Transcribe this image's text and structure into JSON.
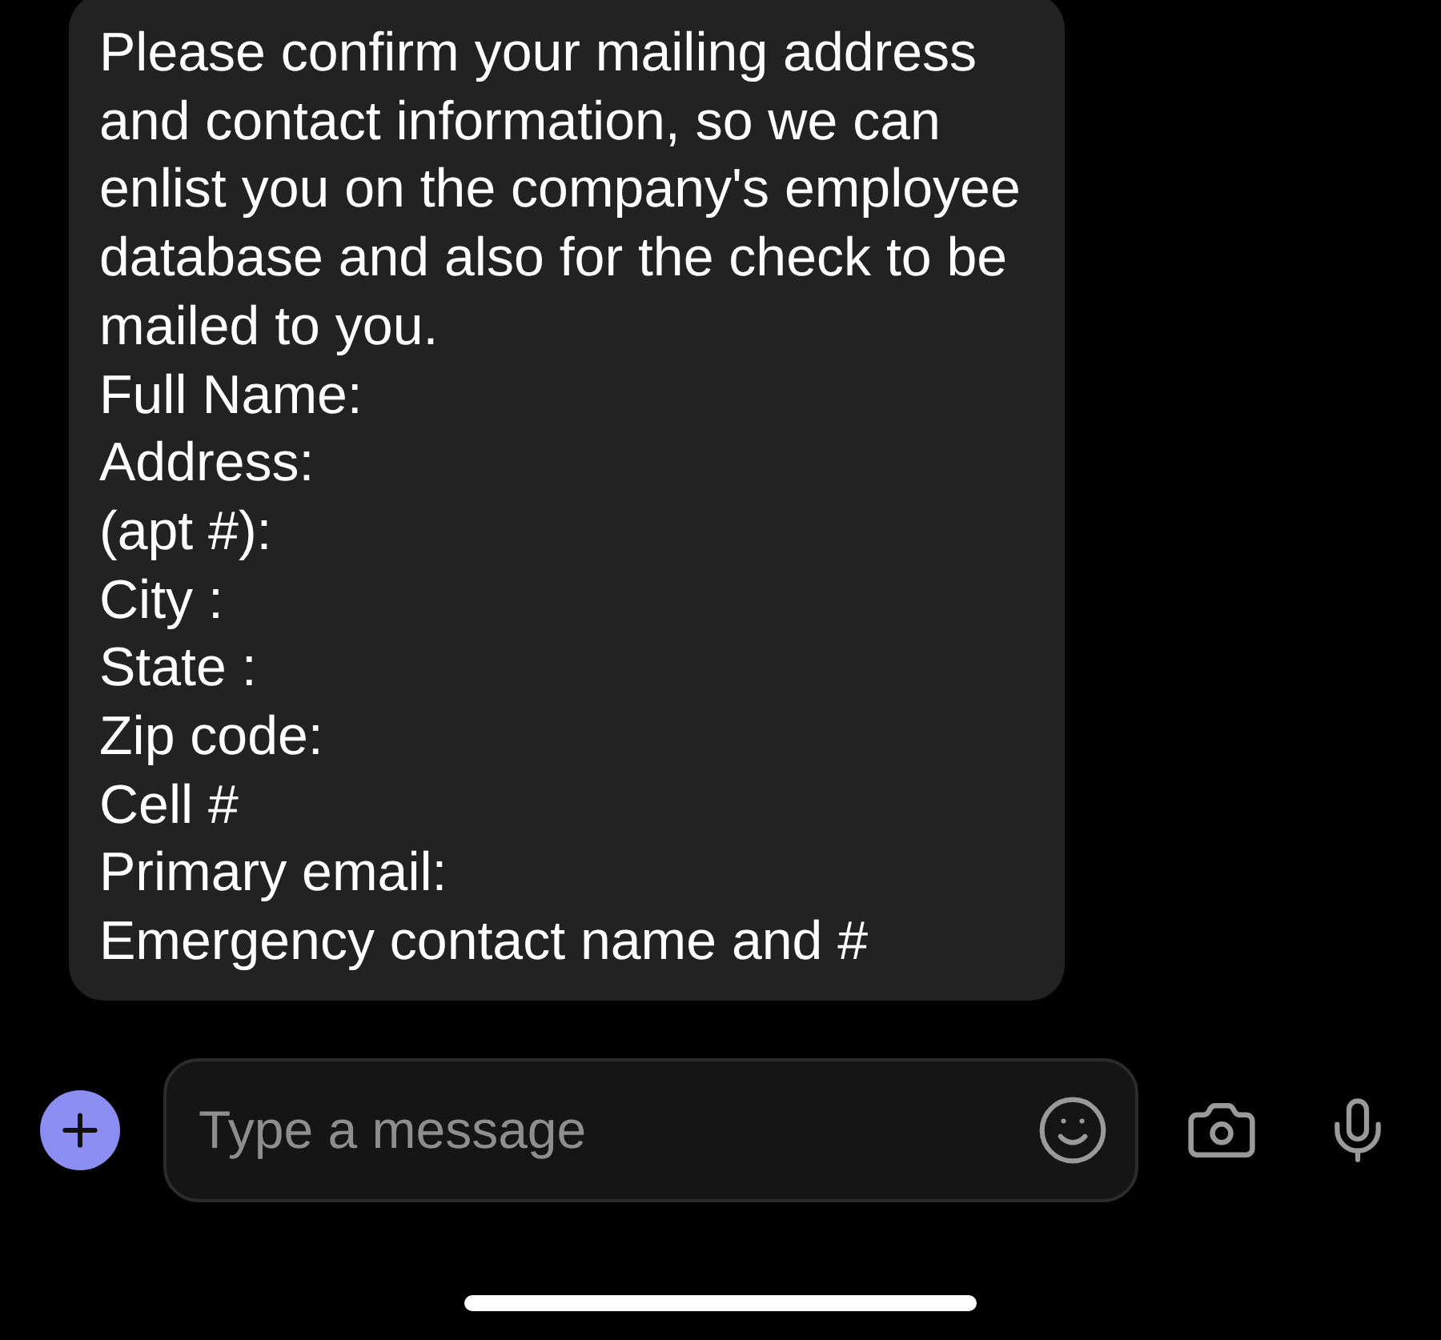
{
  "message": {
    "lines": [
      "Please confirm your mailing address and contact information, so we can enlist you on the company's employee database and also for the check to be mailed to you.",
      "Full Name:",
      "Address:",
      "(apt #):",
      "City :",
      "State :",
      "Zip code:",
      "Cell #",
      "Primary email:",
      "Emergency contact name and #"
    ]
  },
  "composer": {
    "placeholder": "Type a message"
  }
}
